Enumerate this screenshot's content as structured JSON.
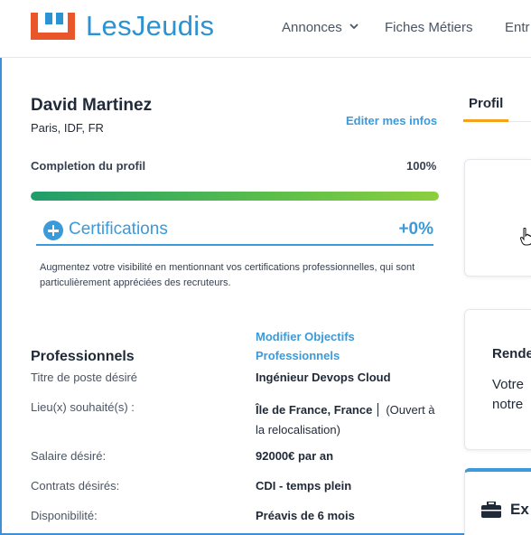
{
  "header": {
    "brand": "LesJeudis",
    "nav": [
      {
        "label": "Annonces"
      },
      {
        "label": "Fiches Métiers"
      },
      {
        "label": "Entr"
      }
    ]
  },
  "profile": {
    "name": "David Martinez",
    "location": "Paris, IDF, FR",
    "edit_link": "Editer mes infos",
    "completion_label": "Completion du profil",
    "completion_value": "100%",
    "completion_fraction": 1.0
  },
  "certifications": {
    "title": "Certifications",
    "gain": "+0%",
    "description": "Augmentez votre visibilité en mentionnant vos certifications professionnelles, qui sont particulièrement appréciées des recruteurs."
  },
  "objectives": {
    "section_title": "Professionnels",
    "modify_link": "Modifier Objectifs Professionnels",
    "job_title_label": "Titre de poste désiré",
    "job_title_value": "Ingénieur Devops Cloud",
    "location_label": "Lieu(x) souhaité(s) :",
    "location_value": "Île de France, France",
    "location_note": "(Ouvert à la relocalisation)",
    "salary_label": "Salaire désiré:",
    "salary_value": "92000€ par an",
    "contract_label": "Contrats désirés:",
    "contract_value": "CDI - temps plein",
    "availability_label": "Disponibilité:",
    "availability_value": "Préavis de 6 mois"
  },
  "sidebar": {
    "tab_label": "Profil",
    "card2_title": "Rende",
    "card2_line1": "Votre",
    "card2_line2": "notre",
    "card3_title": "Ex"
  },
  "colors": {
    "brand_blue": "#2b93d1",
    "brand_orange": "#e8562a",
    "link_blue": "#3b9ad9",
    "tab_accent": "#f4a21b",
    "progress_start": "#1f9d6b",
    "progress_end": "#8ccf3f"
  },
  "icons": [
    "logo-mark-icon",
    "chevron-down-icon",
    "plus-circle-icon",
    "briefcase-icon",
    "hand-cursor-icon"
  ]
}
